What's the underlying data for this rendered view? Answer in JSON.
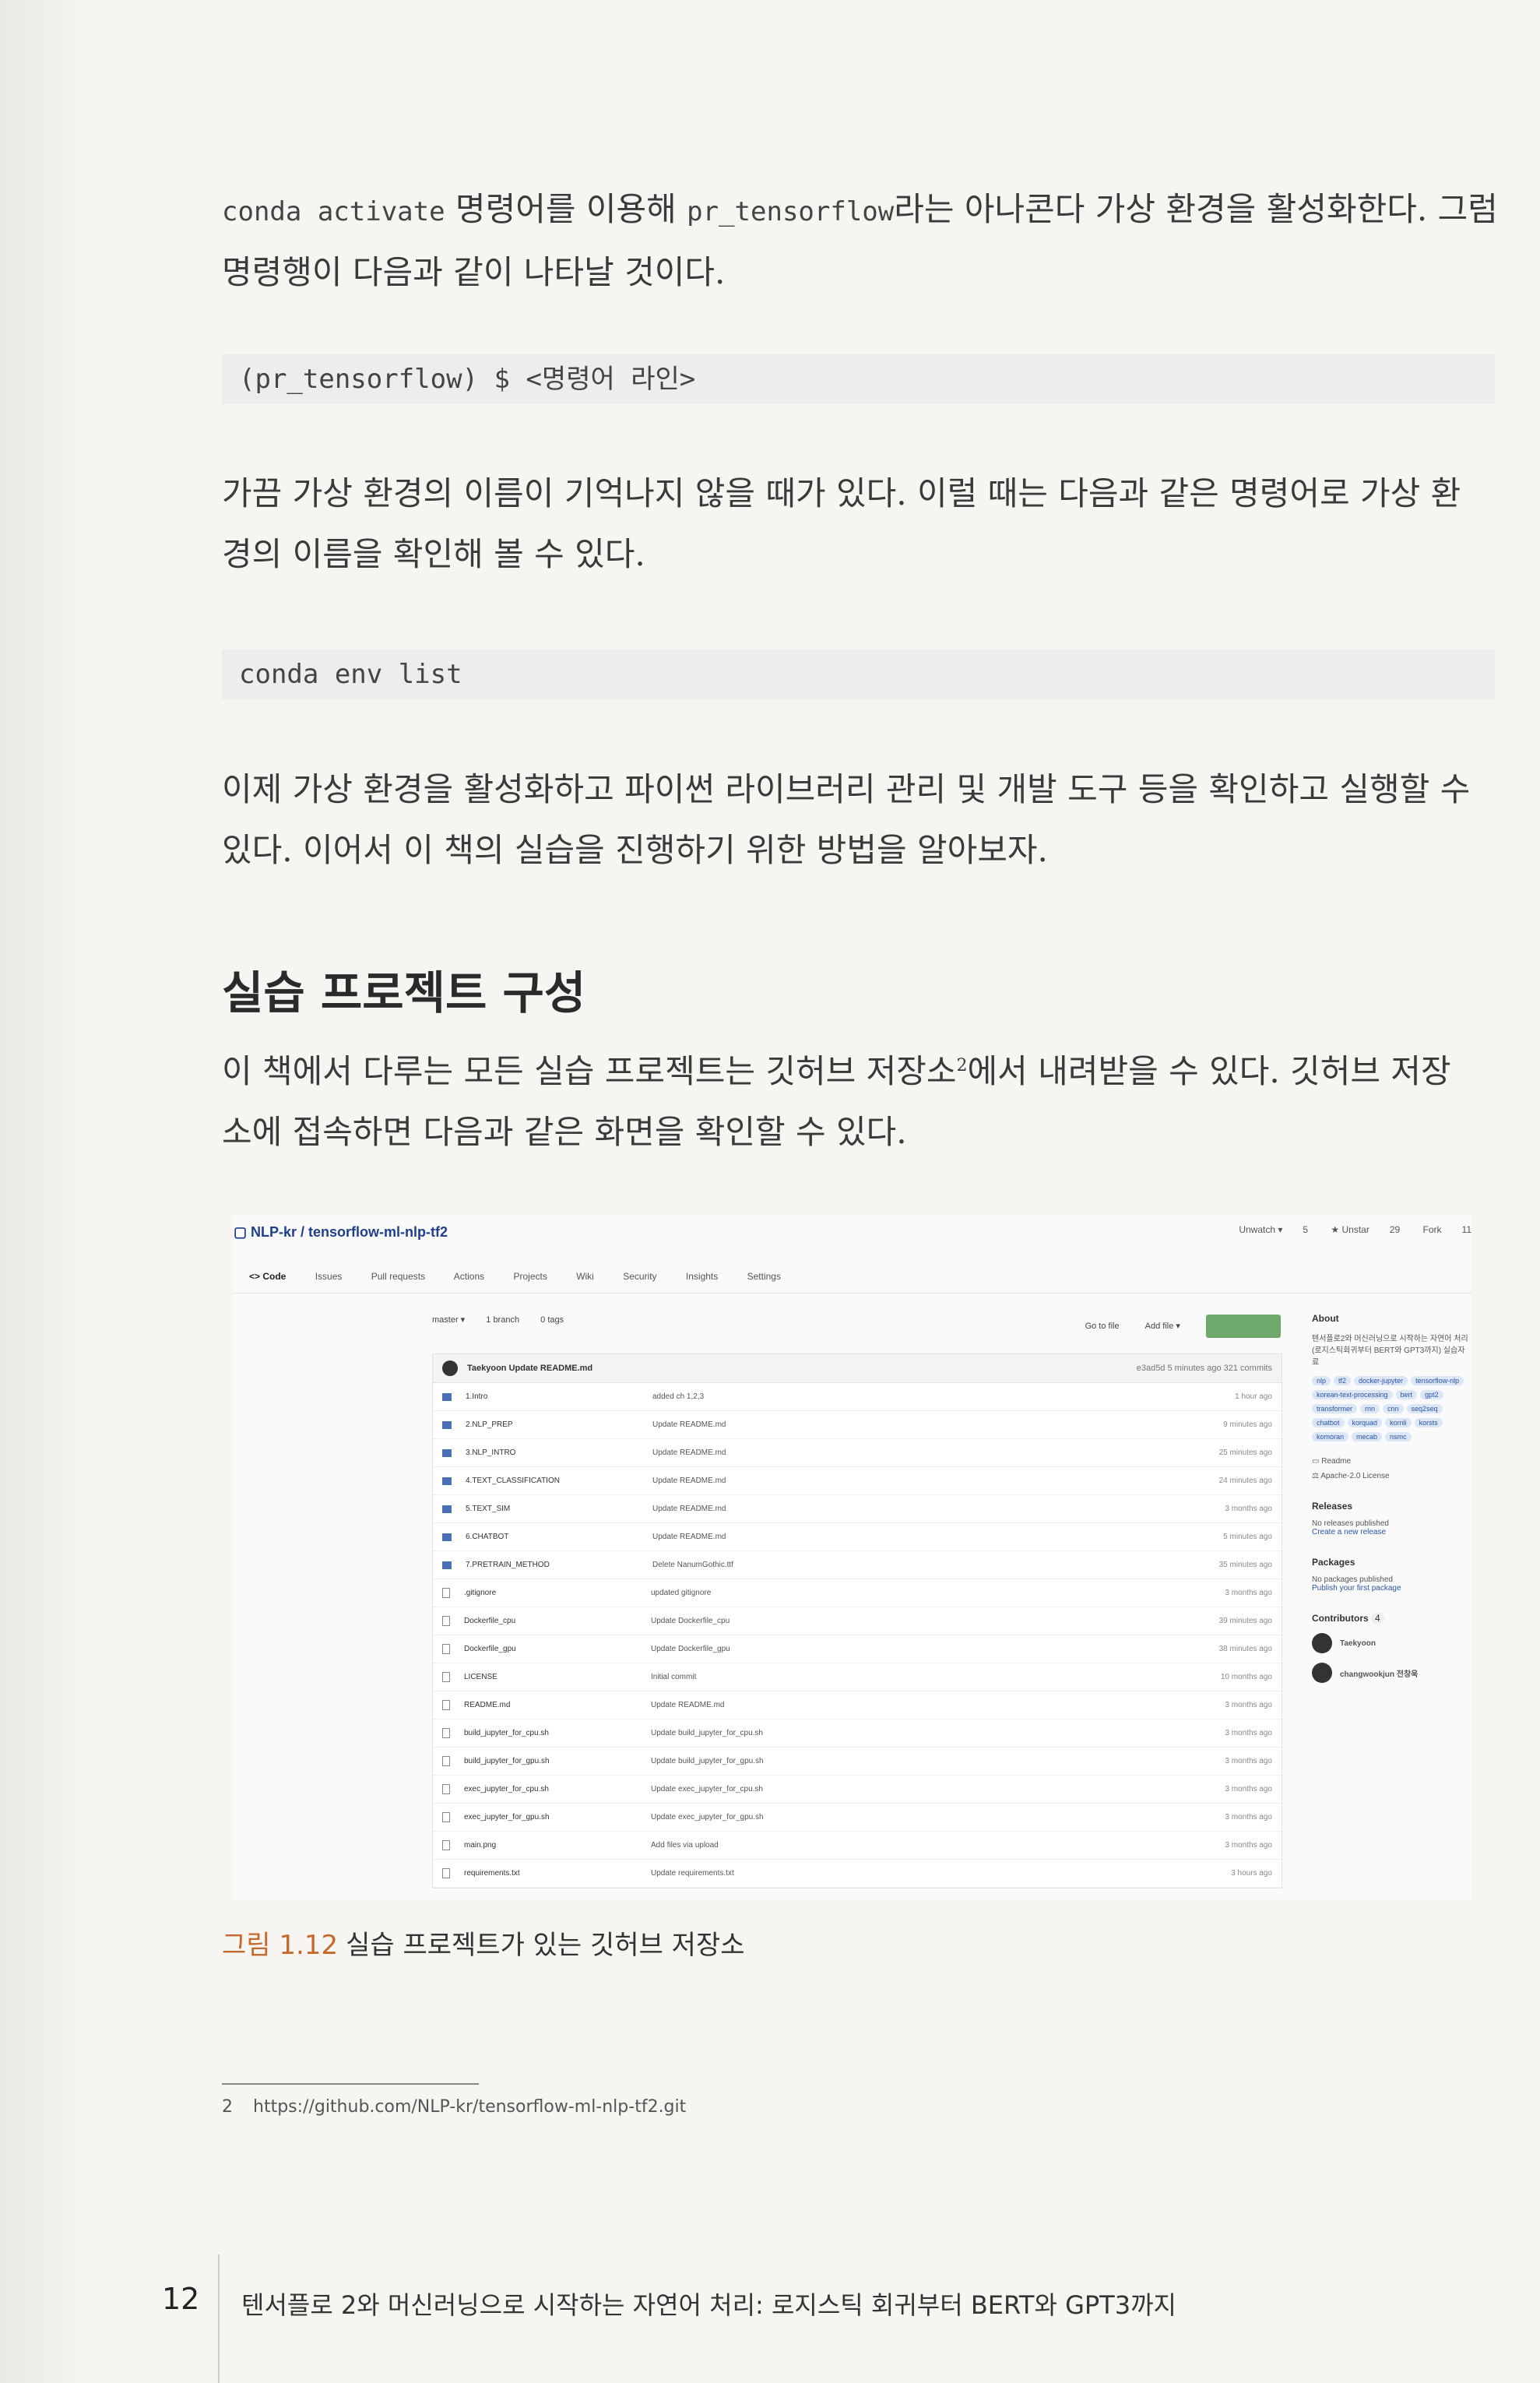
{
  "body": {
    "p1_cmd": "conda activate",
    "p1_text1": " 명령어를 이용해 ",
    "p1_env": "pr_tensorflow",
    "p1_text2": "라는 아나콘다 가상 환경을 활성화한다. 그럼",
    "p1_line2": "명령행이 다음과 같이 나타날 것이다.",
    "code1": "(pr_tensorflow) $ <명령어 라인>",
    "p2_line1": "가끔 가상 환경의 이름이 기억나지 않을 때가 있다. 이럴 때는 다음과 같은 명령어로 가상 환",
    "p2_line2": "경의 이름을 확인해 볼 수 있다.",
    "code2": "conda env list",
    "p3_line1": "이제 가상 환경을 활성화하고 파이썬 라이브러리 관리 및 개발 도구 등을 확인하고 실행할 수",
    "p3_line2": "있다. 이어서 이 책의 실습을 진행하기 위한 방법을 알아보자.",
    "heading": "실습 프로젝트 구성",
    "p4_line1a": "이 책에서 다루는 모든 실습 프로젝트는 깃허브 저장소",
    "p4_sup": "2",
    "p4_line1b": "에서 내려받을 수 있다. 깃허브 저장",
    "p4_line2": "소에 접속하면 다음과 같은 화면을 확인할 수 있다."
  },
  "github": {
    "repo": "NLP-kr / tensorflow-ml-nlp-tf2",
    "actions": [
      "Unwatch ▾",
      "5",
      "★ Unstar",
      "29",
      "Fork",
      "11"
    ],
    "tabs": [
      "<> Code",
      "Issues",
      "Pull requests",
      "Actions",
      "Projects",
      "Wiki",
      "Security",
      "Insights",
      "Settings"
    ],
    "branch": "master ▾",
    "branches": "1 branch",
    "tags": "0 tags",
    "goto": "Go to file",
    "addfile": "Add file ▾",
    "commit_author": "Taekyoon",
    "commit_msg": "Update README.md",
    "commit_meta": "e3ad5d  5 minutes ago   321 commits",
    "files": [
      {
        "type": "dir",
        "name": "1.Intro",
        "commit": "added ch 1,2,3",
        "time": "1 hour ago"
      },
      {
        "type": "dir",
        "name": "2.NLP_PREP",
        "commit": "Update README.md",
        "time": "9 minutes ago"
      },
      {
        "type": "dir",
        "name": "3.NLP_INTRO",
        "commit": "Update README.md",
        "time": "25 minutes ago"
      },
      {
        "type": "dir",
        "name": "4.TEXT_CLASSIFICATION",
        "commit": "Update README.md",
        "time": "24 minutes ago"
      },
      {
        "type": "dir",
        "name": "5.TEXT_SIM",
        "commit": "Update README.md",
        "time": "3 months ago"
      },
      {
        "type": "dir",
        "name": "6.CHATBOT",
        "commit": "Update README.md",
        "time": "5 minutes ago"
      },
      {
        "type": "dir",
        "name": "7.PRETRAIN_METHOD",
        "commit": "Delete NanumGothic.ttf",
        "time": "35 minutes ago"
      },
      {
        "type": "file",
        "name": ".gitignore",
        "commit": "updated gitignore",
        "time": "3 months ago"
      },
      {
        "type": "file",
        "name": "Dockerfile_cpu",
        "commit": "Update Dockerfile_cpu",
        "time": "39 minutes ago"
      },
      {
        "type": "file",
        "name": "Dockerfile_gpu",
        "commit": "Update Dockerfile_gpu",
        "time": "38 minutes ago"
      },
      {
        "type": "file",
        "name": "LICENSE",
        "commit": "Initial commit",
        "time": "10 months ago"
      },
      {
        "type": "file",
        "name": "README.md",
        "commit": "Update README.md",
        "time": "3 months ago"
      },
      {
        "type": "file",
        "name": "build_jupyter_for_cpu.sh",
        "commit": "Update build_jupyter_for_cpu.sh",
        "time": "3 months ago"
      },
      {
        "type": "file",
        "name": "build_jupyter_for_gpu.sh",
        "commit": "Update build_jupyter_for_gpu.sh",
        "time": "3 months ago"
      },
      {
        "type": "file",
        "name": "exec_jupyter_for_cpu.sh",
        "commit": "Update exec_jupyter_for_cpu.sh",
        "time": "3 months ago"
      },
      {
        "type": "file",
        "name": "exec_jupyter_for_gpu.sh",
        "commit": "Update exec_jupyter_for_gpu.sh",
        "time": "3 months ago"
      },
      {
        "type": "file",
        "name": "main.png",
        "commit": "Add files via upload",
        "time": "3 months ago"
      },
      {
        "type": "file",
        "name": "requirements.txt",
        "commit": "Update requirements.txt",
        "time": "3 hours ago"
      }
    ],
    "about_title": "About",
    "about_text": "텐서플로2와 머신러닝으로 시작하는 자연어 처리 (로지스틱회귀부터 BERT와 GPT3까지) 실습자료",
    "topics": [
      "nlp",
      "tf2",
      "docker-jupyter",
      "tensorflow-nlp",
      "korean-text-processing",
      "bert",
      "gpt2",
      "transformer",
      "rnn",
      "cnn",
      "seq2seq",
      "chatbot",
      "korquad",
      "kornli",
      "korsts",
      "komoran",
      "mecab",
      "nsmc"
    ],
    "readme": "Readme",
    "license": "Apache-2.0 License",
    "releases_title": "Releases",
    "releases_text1": "No releases published",
    "releases_text2": "Create a new release",
    "packages_title": "Packages",
    "packages_text1": "No packages published",
    "packages_text2": "Publish your first package",
    "contributors_title": "Contributors",
    "contributors_count": "4",
    "contributors": [
      "Taekyoon",
      "changwookjun 전창욱"
    ]
  },
  "caption": {
    "label": "그림 1.12",
    "text": "실습 프로젝트가 있는 깃허브 저장소"
  },
  "footnote": {
    "num": "2",
    "text": "https://github.com/NLP-kr/tensorflow-ml-nlp-tf2.git"
  },
  "footer": {
    "page": "12",
    "title": "텐서플로 2와 머신러닝으로 시작하는 자연어 처리: 로지스틱 회귀부터 BERT와 GPT3까지"
  }
}
